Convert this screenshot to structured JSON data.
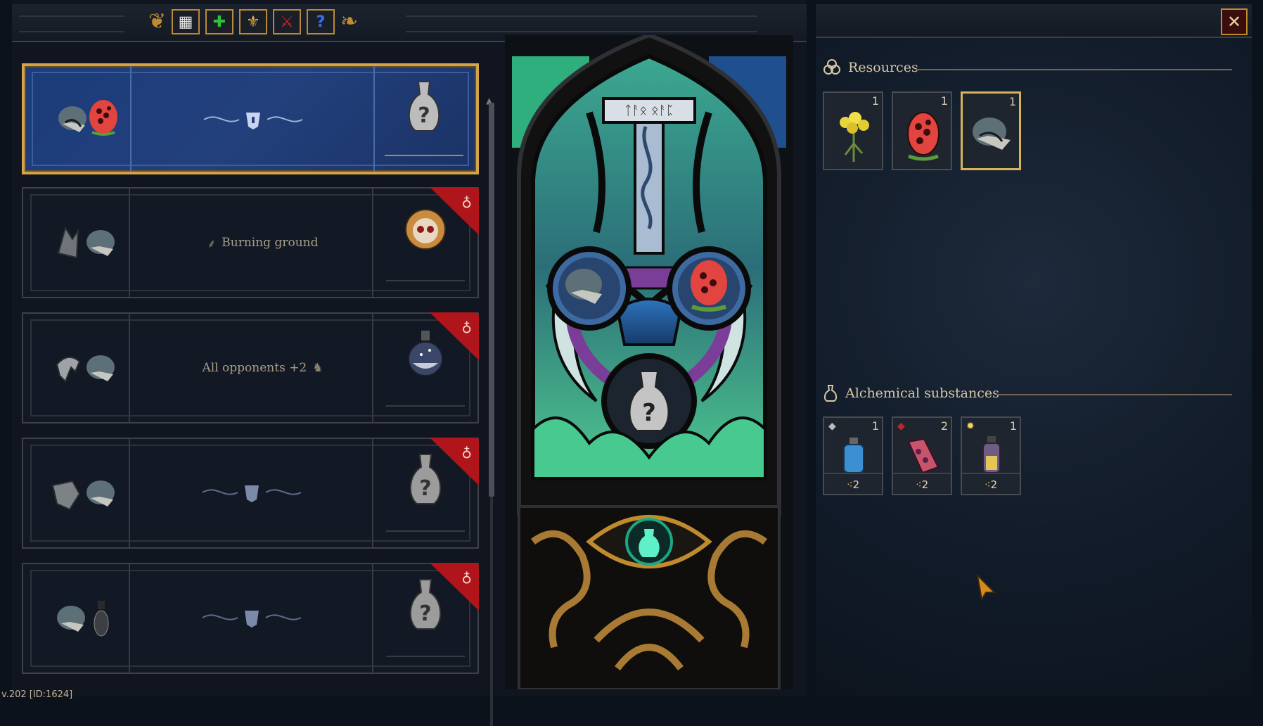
{
  "version": "v.202 [ID:1624]",
  "toolbar": {
    "buttons": [
      {
        "name": "grid",
        "glyph": "▦",
        "color": "#e6e6e6"
      },
      {
        "name": "add",
        "glyph": "✚",
        "color": "#2fc23a"
      },
      {
        "name": "fleur",
        "glyph": "⚜",
        "color": "#e2b03c"
      },
      {
        "name": "cross-swords",
        "glyph": "⚔",
        "color": "#d3242b"
      },
      {
        "name": "help",
        "glyph": "?",
        "color": "#3c6ee6"
      }
    ]
  },
  "recipes": [
    {
      "selected": true,
      "effect": "",
      "ingredients": [
        "sack-icon",
        "red-mushroom-icon"
      ],
      "result": "unknown-potion-icon",
      "locked": false
    },
    {
      "selected": false,
      "effect": "Burning ground",
      "effect_icon": "flame-icon",
      "ingredients": [
        "horn-icon",
        "sack-icon"
      ],
      "result": "skull-orb-icon",
      "locked": true
    },
    {
      "selected": false,
      "effect": "All opponents +2",
      "effect_icon": "dog-icon",
      "ingredients": [
        "bone-icon",
        "sack-icon"
      ],
      "result": "star-flask-icon",
      "locked": true
    },
    {
      "selected": false,
      "effect": "",
      "ingredients": [
        "cloth-icon",
        "sack-icon"
      ],
      "result": "unknown-potion-icon",
      "locked": true
    },
    {
      "selected": false,
      "effect": "",
      "ingredients": [
        "sack-icon",
        "vial-icon"
      ],
      "result": "unknown-potion-icon",
      "locked": true
    }
  ],
  "colors": {
    "gold": "#d3a34a",
    "selected_blue": "#1f3c7a",
    "badge_red": "#b0151b",
    "glass_green": "#45c98c",
    "glass_blue": "#2c74bd"
  },
  "resources": {
    "title": "Resources",
    "items": [
      {
        "icon": "yellow-flower-icon",
        "count": "1"
      },
      {
        "icon": "red-mushroom-icon",
        "count": "1"
      },
      {
        "icon": "sack-icon",
        "count": "1",
        "highlight": true
      }
    ]
  },
  "substances": {
    "title": "Alchemical substances",
    "items": [
      {
        "icon": "blue-bottle-icon",
        "count": "1",
        "cost": "2"
      },
      {
        "icon": "red-scroll-icon",
        "count": "2",
        "cost": "2"
      },
      {
        "icon": "yellow-bottle-icon",
        "count": "1",
        "cost": "2"
      }
    ]
  },
  "close_glyph": "✕"
}
